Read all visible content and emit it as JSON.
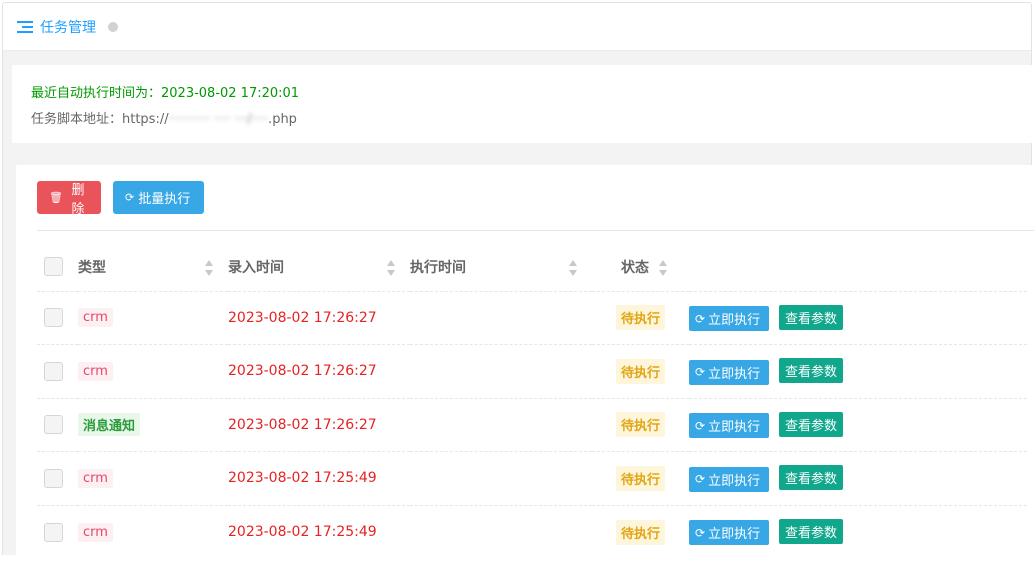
{
  "header": {
    "title": "任务管理"
  },
  "info": {
    "last_run": "最近自动执行时间为：2023-08-02 17:20:01",
    "script_label": "任务脚本地址：https://",
    "script_blurred": "·········· ····  ···/····",
    "script_suffix": "php"
  },
  "toolbar": {
    "delete_label": "删除",
    "batch_label": "批量执行"
  },
  "table": {
    "columns": [
      "类型",
      "录入时间",
      "执行时间",
      "状态"
    ],
    "rows": [
      {
        "type": "crm",
        "created": "2023-08-02 17:26:27",
        "executed": "",
        "status": "待执行",
        "run_label": "立即执行",
        "view_label": "查看参数"
      },
      {
        "type": "crm",
        "created": "2023-08-02 17:26:27",
        "executed": "",
        "status": "待执行",
        "run_label": "立即执行",
        "view_label": "查看参数"
      },
      {
        "type": "消息通知",
        "created": "2023-08-02 17:26:27",
        "executed": "",
        "status": "待执行",
        "run_label": "立即执行",
        "view_label": "查看参数"
      },
      {
        "type": "crm",
        "created": "2023-08-02 17:25:49",
        "executed": "",
        "status": "待执行",
        "run_label": "立即执行",
        "view_label": "查看参数"
      },
      {
        "type": "crm",
        "created": "2023-08-02 17:25:49",
        "executed": "",
        "status": "待执行",
        "run_label": "立即执行",
        "view_label": "查看参数"
      }
    ]
  },
  "colors": {
    "accent": "#1e9fff",
    "danger": "#e9545a",
    "info": "#37a7e6",
    "success": "#11a78c",
    "time": "#e62222"
  },
  "icons": {
    "menu": "list-icon",
    "delete": "trash-icon",
    "refresh": "refresh-icon"
  }
}
